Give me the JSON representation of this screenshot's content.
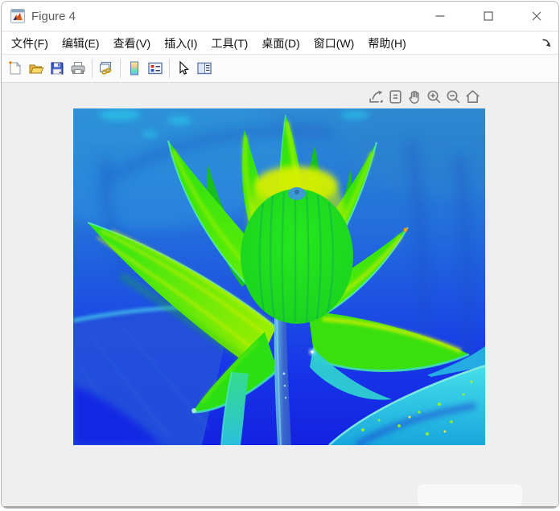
{
  "window": {
    "title": "Figure 4",
    "app_icon": "matlab-figure-icon",
    "controls": [
      {
        "name": "minimize"
      },
      {
        "name": "maximize"
      },
      {
        "name": "close"
      }
    ]
  },
  "menu_bar": {
    "items": [
      {
        "id": "file",
        "label": "文件(F)"
      },
      {
        "id": "edit",
        "label": "编辑(E)"
      },
      {
        "id": "view",
        "label": "查看(V)"
      },
      {
        "id": "insert",
        "label": "插入(I)"
      },
      {
        "id": "tools",
        "label": "工具(T)"
      },
      {
        "id": "desktop",
        "label": "桌面(D)"
      },
      {
        "id": "window",
        "label": "窗口(W)"
      },
      {
        "id": "help",
        "label": "帮助(H)"
      }
    ],
    "dock_icon": "dock-arrow-icon"
  },
  "toolbar": {
    "items": [
      {
        "name": "new-figure-icon"
      },
      {
        "name": "open-file-icon"
      },
      {
        "name": "save-figure-icon"
      },
      {
        "name": "print-figure-icon"
      },
      {
        "name": "link-plot-icon"
      },
      {
        "name": "insert-colorbar-icon"
      },
      {
        "name": "insert-legend-icon"
      },
      {
        "name": "edit-plot-icon"
      },
      {
        "name": "property-inspector-icon"
      }
    ]
  },
  "axes_toolbar": {
    "items": [
      {
        "name": "export-icon"
      },
      {
        "name": "datatip-icon"
      },
      {
        "name": "pan-icon"
      },
      {
        "name": "zoom-in-icon"
      },
      {
        "name": "zoom-out-icon"
      },
      {
        "name": "restore-view-icon"
      }
    ]
  },
  "figure": {
    "description": "False-color (jet colormap) photo of a lotus flower: bright green petals with yellow highlights over a blue background, cyan leaves at lower right, blue-cyan stem at lower center",
    "colors": {
      "background_top": "#2e8bd2",
      "background_bottom": "#1322e0",
      "petal_green": "#2ae014",
      "petal_yellow": "#c8ee00",
      "leaf_cyan": "#2ecfe4",
      "stem_blue": "#3f77cc",
      "bud_tip_blue": "#3b9ad2"
    }
  }
}
